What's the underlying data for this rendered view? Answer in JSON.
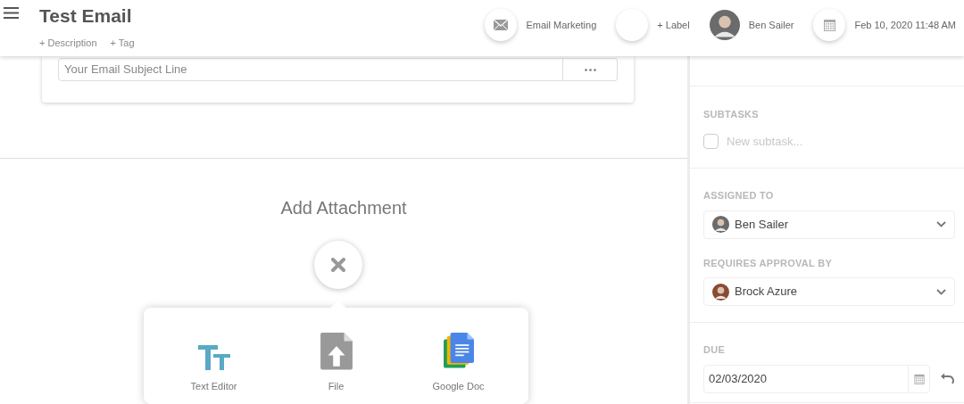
{
  "header": {
    "title": "Test Email",
    "links": [
      "+ Description",
      "+ Tag"
    ],
    "chips": [
      {
        "kind": "email",
        "label": "Email Marketing"
      },
      {
        "kind": "empty",
        "label": "+ Label"
      },
      {
        "kind": "avatar",
        "label": "Ben Sailer"
      },
      {
        "kind": "calendar",
        "label": "Feb 10, 2020 11:48 AM"
      }
    ]
  },
  "subject": {
    "placeholder": "Your Email Subject Line"
  },
  "attachment": {
    "title": "Add Attachment",
    "options": [
      {
        "kind": "text-editor",
        "label": "Text Editor"
      },
      {
        "kind": "file",
        "label": "File"
      },
      {
        "kind": "google-doc",
        "label": "Google Doc"
      }
    ]
  },
  "sidebar": {
    "subtasks": {
      "label": "SUBTASKS",
      "checked": false,
      "placeholder": "New subtask..."
    },
    "assigned": {
      "label": "ASSIGNED TO",
      "value": "Ben Sailer"
    },
    "approval": {
      "label": "REQUIRES APPROVAL BY",
      "value": "Brock Azure"
    },
    "due": {
      "label": "DUE",
      "value": "02/03/2020"
    }
  }
}
